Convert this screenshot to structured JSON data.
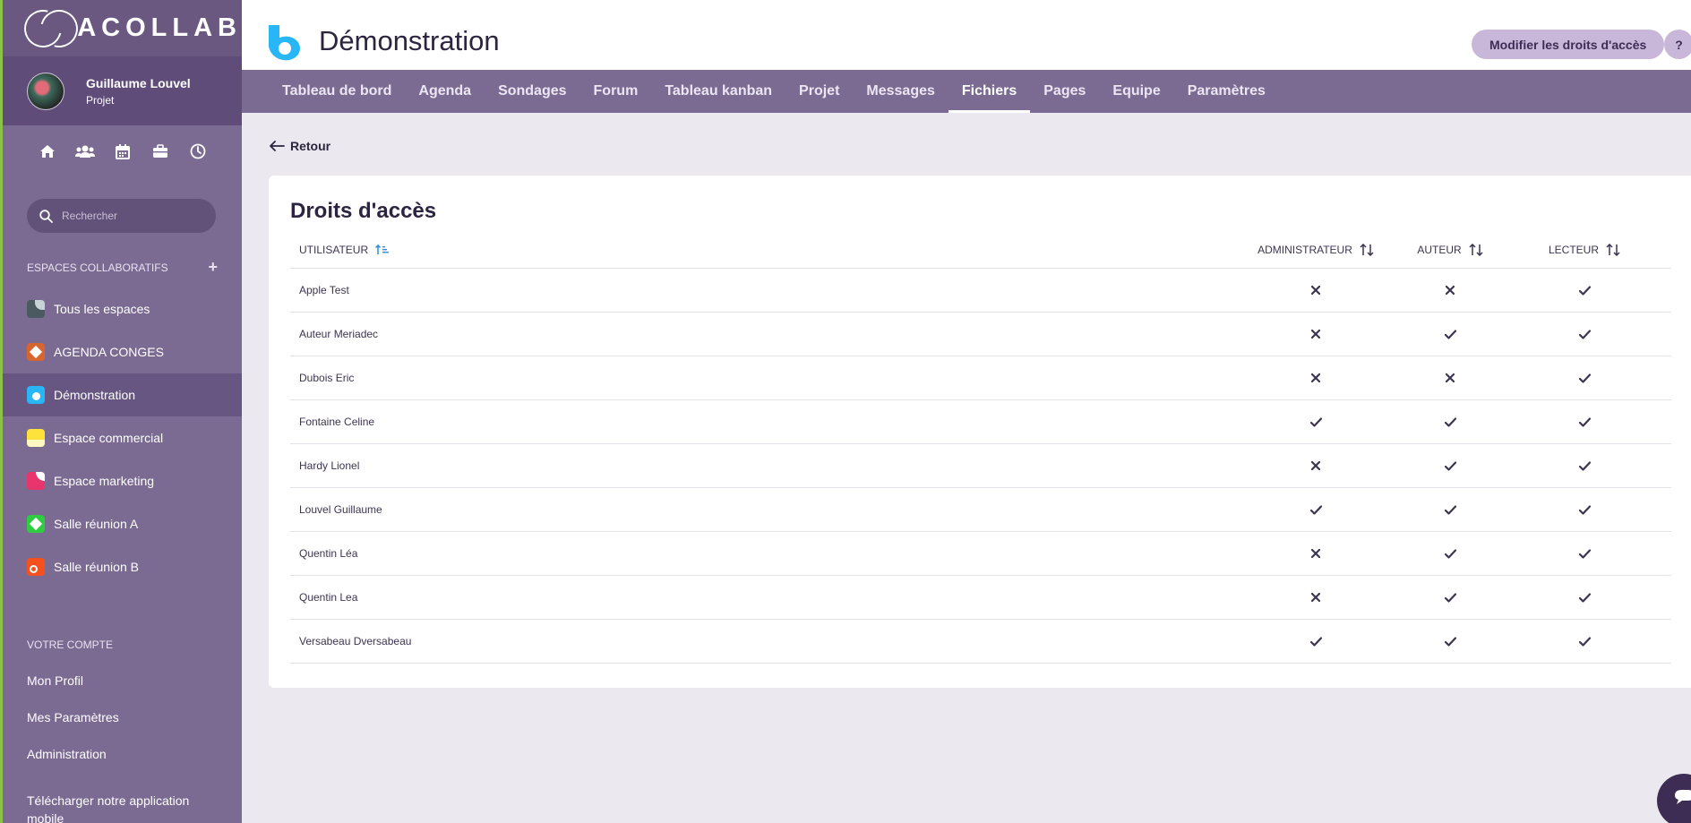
{
  "sidebar": {
    "logo_text": "ACOLLAB",
    "user": {
      "name": "Guillaume Louvel",
      "role": "Projet"
    },
    "quick_icons": [
      "home-icon",
      "users-icon",
      "calendar-icon",
      "briefcase-icon",
      "clock-icon"
    ],
    "search_placeholder": "Rechercher",
    "spaces_title": "ESPACES COLLABORATIFS",
    "spaces": [
      {
        "label": "Tous les espaces",
        "color": "#4a5a60"
      },
      {
        "label": "AGENDA CONGES",
        "color": "#d9652e"
      },
      {
        "label": "Démonstration",
        "color": "#29b6f6"
      },
      {
        "label": "Espace commercial",
        "color": "#fde23c"
      },
      {
        "label": "Espace marketing",
        "color": "#e8356d"
      },
      {
        "label": "Salle réunion A",
        "color": "#2ecc40"
      },
      {
        "label": "Salle réunion B",
        "color": "#f4511e"
      }
    ],
    "account_title": "VOTRE COMPTE",
    "account_items": [
      "Mon Profil",
      "Mes Paramètres",
      "Administration"
    ],
    "download_label": "Télécharger notre application mobile"
  },
  "header": {
    "title": "Démonstration",
    "rights_button": "Modifier les droits d'accès",
    "help_button": "?"
  },
  "nav": {
    "tabs": [
      "Tableau de bord",
      "Agenda",
      "Sondages",
      "Forum",
      "Tableau kanban",
      "Projet",
      "Messages",
      "Fichiers",
      "Pages",
      "Equipe",
      "Paramètres"
    ],
    "active": "Fichiers"
  },
  "main": {
    "back_label": "Retour",
    "card_title": "Droits d'accès",
    "columns": {
      "user": "UTILISATEUR",
      "admin": "ADMINISTRATEUR",
      "auteur": "AUTEUR",
      "lecteur": "LECTEUR"
    },
    "rows": [
      {
        "name": "Apple Test",
        "admin": false,
        "auteur": false,
        "lecteur": true
      },
      {
        "name": "Auteur Meriadec",
        "admin": false,
        "auteur": true,
        "lecteur": true
      },
      {
        "name": "Dubois Eric",
        "admin": false,
        "auteur": false,
        "lecteur": true
      },
      {
        "name": "Fontaine Celine",
        "admin": true,
        "auteur": true,
        "lecteur": true
      },
      {
        "name": "Hardy Lionel",
        "admin": false,
        "auteur": true,
        "lecteur": true
      },
      {
        "name": "Louvel Guillaume",
        "admin": true,
        "auteur": true,
        "lecteur": true
      },
      {
        "name": "Quentin Léa",
        "admin": false,
        "auteur": true,
        "lecteur": true
      },
      {
        "name": "Quentin Lea",
        "admin": false,
        "auteur": true,
        "lecteur": true
      },
      {
        "name": "Versabeau Dversabeau",
        "admin": true,
        "auteur": true,
        "lecteur": true
      }
    ]
  }
}
